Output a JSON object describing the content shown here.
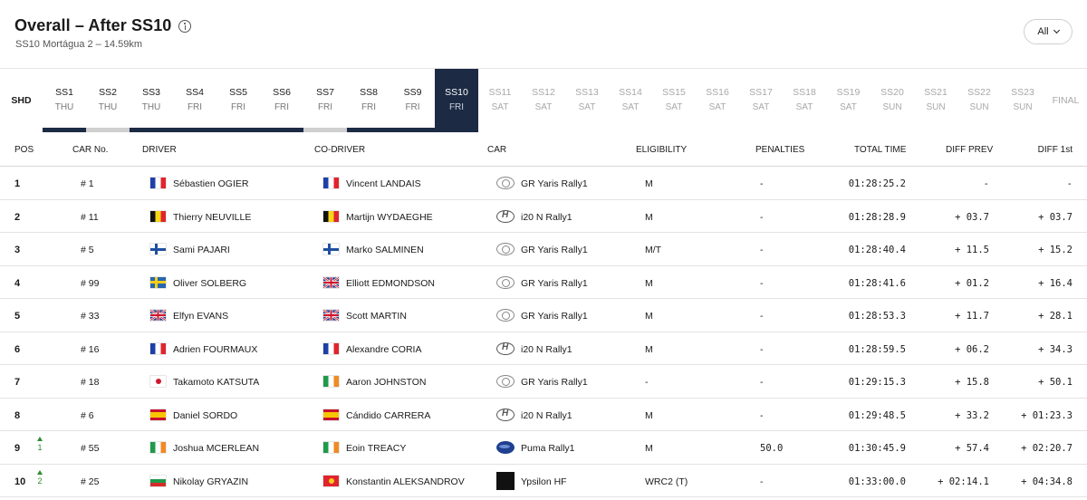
{
  "header": {
    "title": "Overall – After SS10",
    "subtitle": "SS10 Mortágua 2 – 14.59km",
    "filter_label": "All"
  },
  "stages": [
    {
      "code": "SHD",
      "day": "",
      "state": "shd"
    },
    {
      "code": "SS1",
      "day": "THU",
      "state": "done",
      "bar": "dark"
    },
    {
      "code": "SS2",
      "day": "THU",
      "state": "done",
      "bar": "grey"
    },
    {
      "code": "SS3",
      "day": "THU",
      "state": "done",
      "bar": "dark"
    },
    {
      "code": "SS4",
      "day": "FRI",
      "state": "done",
      "bar": "dark"
    },
    {
      "code": "SS5",
      "day": "FRI",
      "state": "done",
      "bar": "dark"
    },
    {
      "code": "SS6",
      "day": "FRI",
      "state": "done",
      "bar": "dark"
    },
    {
      "code": "SS7",
      "day": "FRI",
      "state": "done",
      "bar": "grey"
    },
    {
      "code": "SS8",
      "day": "FRI",
      "state": "done",
      "bar": "dark"
    },
    {
      "code": "SS9",
      "day": "FRI",
      "state": "done",
      "bar": "dark"
    },
    {
      "code": "SS10",
      "day": "FRI",
      "state": "active"
    },
    {
      "code": "SS11",
      "day": "SAT",
      "state": "future"
    },
    {
      "code": "SS12",
      "day": "SAT",
      "state": "future"
    },
    {
      "code": "SS13",
      "day": "SAT",
      "state": "future"
    },
    {
      "code": "SS14",
      "day": "SAT",
      "state": "future"
    },
    {
      "code": "SS15",
      "day": "SAT",
      "state": "future"
    },
    {
      "code": "SS16",
      "day": "SAT",
      "state": "future"
    },
    {
      "code": "SS17",
      "day": "SAT",
      "state": "future"
    },
    {
      "code": "SS18",
      "day": "SAT",
      "state": "future"
    },
    {
      "code": "SS19",
      "day": "SAT",
      "state": "future"
    },
    {
      "code": "SS20",
      "day": "SUN",
      "state": "future"
    },
    {
      "code": "SS21",
      "day": "SUN",
      "state": "future"
    },
    {
      "code": "SS22",
      "day": "SUN",
      "state": "future"
    },
    {
      "code": "SS23",
      "day": "SUN",
      "state": "future"
    },
    {
      "code": "FINAL",
      "day": "",
      "state": "final"
    }
  ],
  "columns": {
    "pos": "POS",
    "car_no": "CAR No.",
    "driver": "DRIVER",
    "co_driver": "CO-DRIVER",
    "car": "CAR",
    "eligibility": "ELIGIBILITY",
    "penalties": "PENALTIES",
    "total_time": "TOTAL TIME",
    "diff_prev": "DIFF PREV",
    "diff_first": "DIFF 1st"
  },
  "rows": [
    {
      "pos": "1",
      "change": "",
      "car_no": "# 1",
      "driver": "Sébastien OGIER",
      "driver_flag": "fr",
      "co_driver": "Vincent LANDAIS",
      "co_flag": "fr",
      "car": "GR Yaris Rally1",
      "make_icon": "toyota-icon",
      "eligibility": "M",
      "penalties": "-",
      "total_time": "01:28:25.2",
      "diff_prev": "-",
      "diff_first": "-"
    },
    {
      "pos": "2",
      "change": "",
      "car_no": "# 11",
      "driver": "Thierry NEUVILLE",
      "driver_flag": "be",
      "co_driver": "Martijn WYDAEGHE",
      "co_flag": "be",
      "car": "i20 N Rally1",
      "make_icon": "hyundai-icon",
      "eligibility": "M",
      "penalties": "-",
      "total_time": "01:28:28.9",
      "diff_prev": "+ 03.7",
      "diff_first": "+ 03.7"
    },
    {
      "pos": "3",
      "change": "",
      "car_no": "# 5",
      "driver": "Sami PAJARI",
      "driver_flag": "fi",
      "co_driver": "Marko SALMINEN",
      "co_flag": "fi",
      "car": "GR Yaris Rally1",
      "make_icon": "toyota-icon",
      "eligibility": "M/T",
      "penalties": "-",
      "total_time": "01:28:40.4",
      "diff_prev": "+ 11.5",
      "diff_first": "+ 15.2"
    },
    {
      "pos": "4",
      "change": "",
      "car_no": "# 99",
      "driver": "Oliver SOLBERG",
      "driver_flag": "se",
      "co_driver": "Elliott EDMONDSON",
      "co_flag": "gb",
      "car": "GR Yaris Rally1",
      "make_icon": "toyota-icon",
      "eligibility": "M",
      "penalties": "-",
      "total_time": "01:28:41.6",
      "diff_prev": "+ 01.2",
      "diff_first": "+ 16.4"
    },
    {
      "pos": "5",
      "change": "",
      "car_no": "# 33",
      "driver": "Elfyn EVANS",
      "driver_flag": "gb",
      "co_driver": "Scott MARTIN",
      "co_flag": "gb",
      "car": "GR Yaris Rally1",
      "make_icon": "toyota-icon",
      "eligibility": "M",
      "penalties": "-",
      "total_time": "01:28:53.3",
      "diff_prev": "+ 11.7",
      "diff_first": "+ 28.1"
    },
    {
      "pos": "6",
      "change": "",
      "car_no": "# 16",
      "driver": "Adrien FOURMAUX",
      "driver_flag": "fr",
      "co_driver": "Alexandre CORIA",
      "co_flag": "fr",
      "car": "i20 N Rally1",
      "make_icon": "hyundai-icon",
      "eligibility": "M",
      "penalties": "-",
      "total_time": "01:28:59.5",
      "diff_prev": "+ 06.2",
      "diff_first": "+ 34.3"
    },
    {
      "pos": "7",
      "change": "",
      "car_no": "# 18",
      "driver": "Takamoto KATSUTA",
      "driver_flag": "jp",
      "co_driver": "Aaron JOHNSTON",
      "co_flag": "ie",
      "car": "GR Yaris Rally1",
      "make_icon": "toyota-icon",
      "eligibility": "-",
      "penalties": "-",
      "total_time": "01:29:15.3",
      "diff_prev": "+ 15.8",
      "diff_first": "+ 50.1"
    },
    {
      "pos": "8",
      "change": "",
      "car_no": "# 6",
      "driver": "Daniel SORDO",
      "driver_flag": "es",
      "co_driver": "Cándido CARRERA",
      "co_flag": "es",
      "car": "i20 N Rally1",
      "make_icon": "hyundai-icon",
      "eligibility": "M",
      "penalties": "-",
      "total_time": "01:29:48.5",
      "diff_prev": "+ 33.2",
      "diff_first": "+ 01:23.3"
    },
    {
      "pos": "9",
      "change": "1",
      "car_no": "# 55",
      "driver": "Joshua MCERLEAN",
      "driver_flag": "ie",
      "co_driver": "Eoin TREACY",
      "co_flag": "ie",
      "car": "Puma Rally1",
      "make_icon": "ford-icon",
      "eligibility": "M",
      "penalties": "50.0",
      "total_time": "01:30:45.9",
      "diff_prev": "+ 57.4",
      "diff_first": "+ 02:20.7"
    },
    {
      "pos": "10",
      "change": "2",
      "car_no": "# 25",
      "driver": "Nikolay GRYAZIN",
      "driver_flag": "bg",
      "co_driver": "Konstantin ALEKSANDROV",
      "co_flag": "kg",
      "car": "Ypsilon HF",
      "make_icon": "lancia-icon",
      "eligibility": "WRC2 (T)",
      "penalties": "-",
      "total_time": "01:33:00.0",
      "diff_prev": "+ 02:14.1",
      "diff_first": "+ 04:34.8"
    }
  ],
  "colors": {
    "active_stage": "#1c2a44",
    "position_up": "#2e8b2e"
  }
}
